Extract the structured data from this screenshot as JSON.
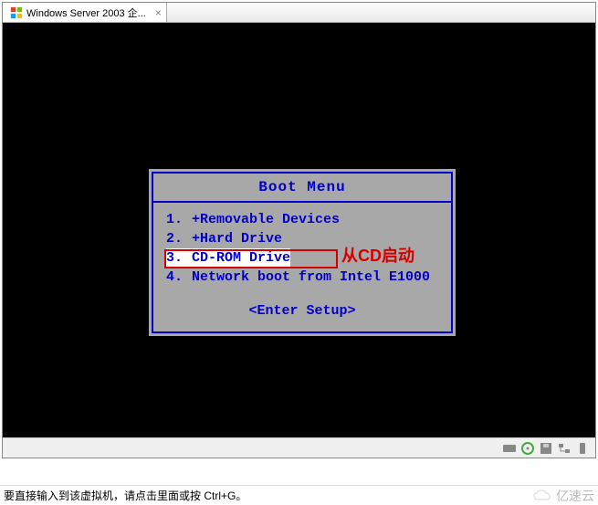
{
  "tab": {
    "title": "Windows Server 2003 企...",
    "close_glyph": "×"
  },
  "boot_menu": {
    "title": "Boot Menu",
    "items": [
      {
        "num": "1.",
        "label": "+Removable Devices"
      },
      {
        "num": "2.",
        "label": "+Hard Drive"
      },
      {
        "num": "3.",
        "label": " CD-ROM Drive"
      },
      {
        "num": "4.",
        "label": " Network boot from Intel E1000"
      }
    ],
    "selected_index": 2,
    "annotation": "从CD启动",
    "enter_setup": "<Enter Setup>"
  },
  "status_bar": {
    "hint": "要直接输入到该虚拟机，请点击里面或按 Ctrl+G。"
  },
  "watermark": {
    "text": "亿速云"
  }
}
